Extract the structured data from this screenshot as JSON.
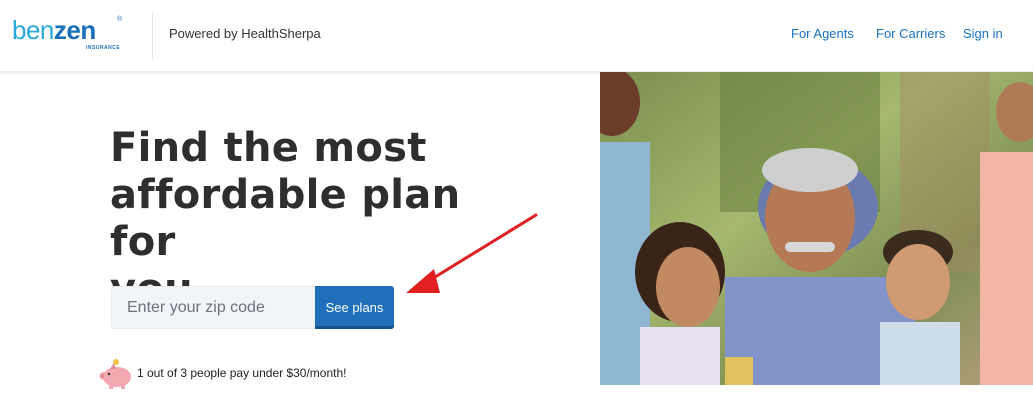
{
  "header": {
    "logo": {
      "part1": "ben",
      "part2": "zen",
      "registered": "®",
      "subtitle": "INSURANCE"
    },
    "powered_by": "Powered by HealthSherpa",
    "nav": {
      "agents": "For Agents",
      "carriers": "For Carriers",
      "signin": "Sign in"
    }
  },
  "hero": {
    "headline_line1": "Find the most",
    "headline_line2": "affordable plan for",
    "headline_line3": "you.",
    "zip_placeholder": "Enter your zip code",
    "zip_value": "",
    "button_label": "See plans",
    "stat_text": "1 out of 3 people pay under $30/month!"
  },
  "colors": {
    "brand_light": "#2aa8d8",
    "brand_dark": "#1a6fb8",
    "link": "#1a72c2",
    "button": "#1f6fba",
    "annotation_arrow": "#e02020",
    "piggy": "#f3a7b0"
  },
  "icons": {
    "piggy": "piggy-bank-icon",
    "arrow": "arrow-annotation-icon"
  }
}
